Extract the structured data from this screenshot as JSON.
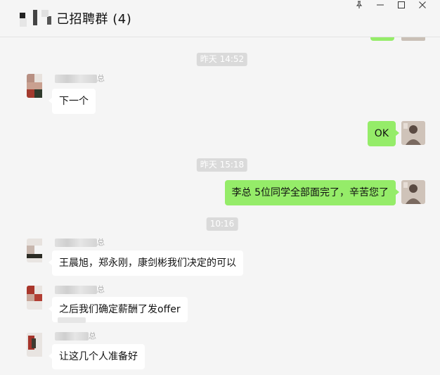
{
  "window": {
    "title": "招聘群 (4)",
    "title_fragment": "己",
    "controls": [
      "pin-icon",
      "minimize-icon",
      "maximize-icon",
      "close-icon"
    ]
  },
  "colors": {
    "background": "#f5f5f5",
    "bubble_out": "#95ec69",
    "bubble_in": "#ffffff",
    "timestamp_bg": "#dadada"
  },
  "messages": {
    "t1": "昨天 14:52",
    "m1_sender_suffix": "总",
    "m1_text": "下一个",
    "m2_text": "OK",
    "t2": "昨天 15:18",
    "m3_text": "李总 5位同学全部面完了，辛苦您了",
    "t3": "10:16",
    "m4_sender_suffix": "总",
    "m4_text": "王晨旭，郑永刚，康剑彬我们决定的可以",
    "m5_sender_suffix": "总",
    "m5_text": "之后我们确定薪酬了发offer",
    "m6_sender_suffix": "总",
    "m6_text": "让这几个人准备好"
  }
}
